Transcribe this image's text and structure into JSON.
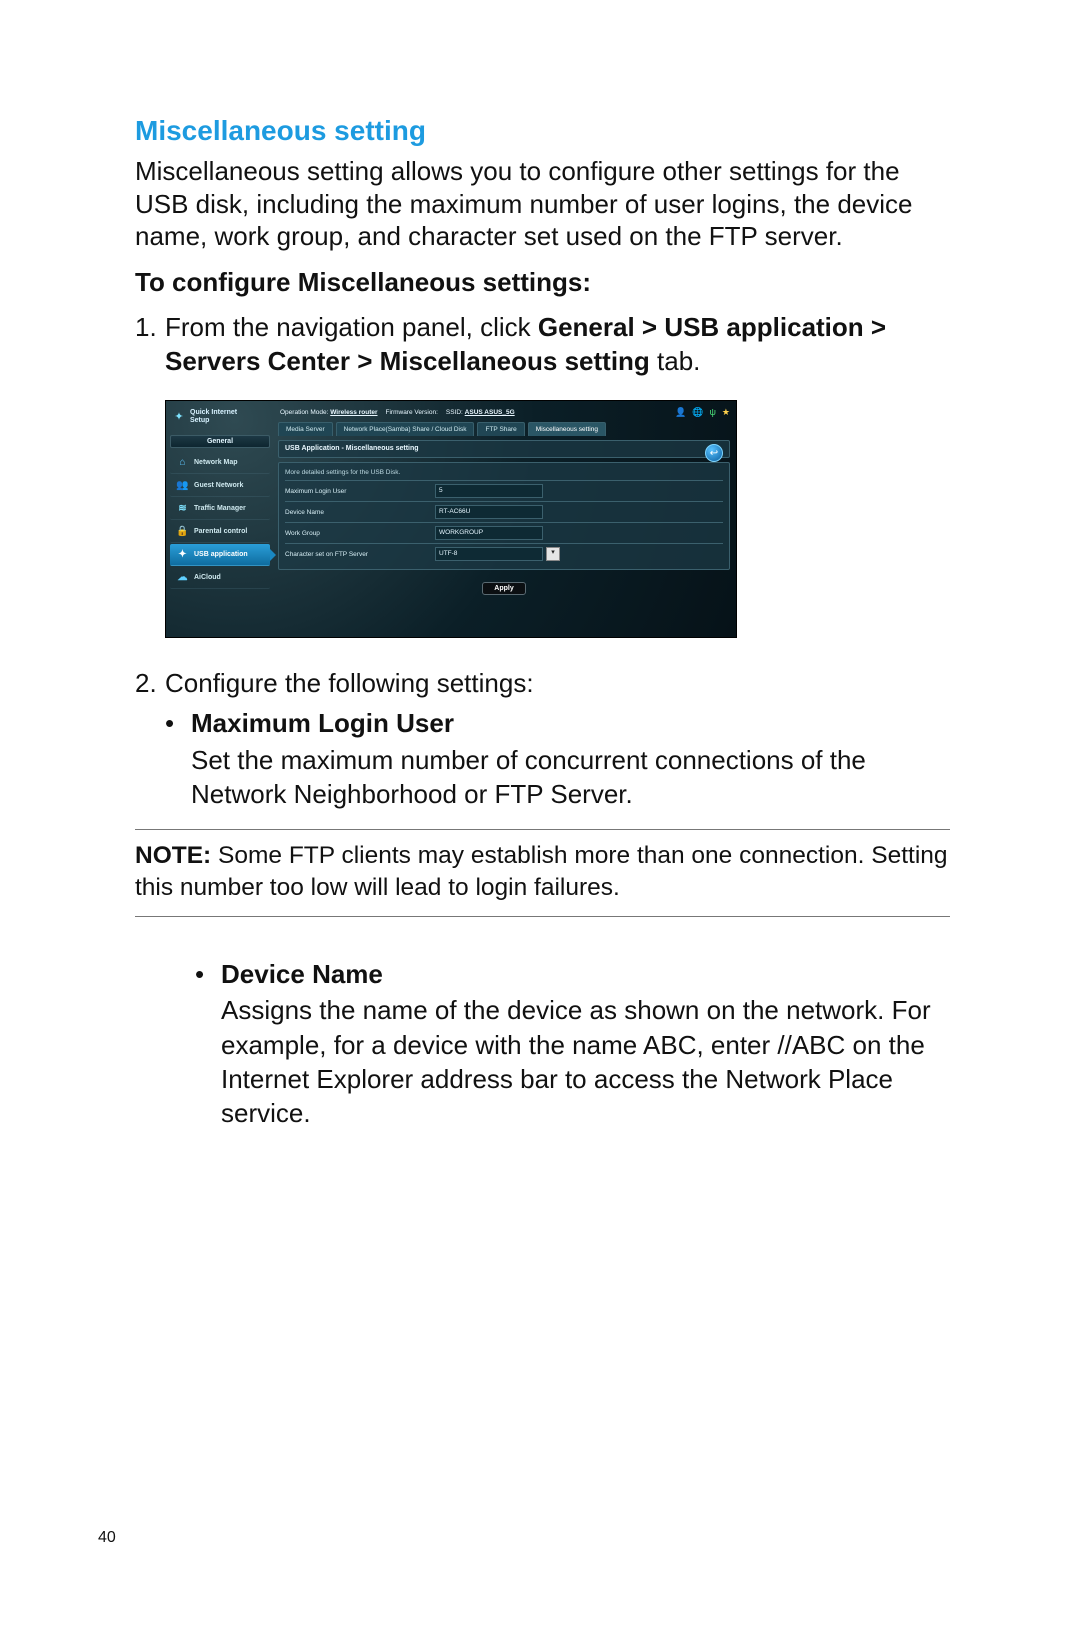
{
  "page_number": "40",
  "section_title": "Miscellaneous setting",
  "intro": "Miscellaneous setting allows you to configure other settings for the USB disk, including the maximum number of user logins, the device name, work group, and character set used on the FTP server.",
  "subhead": "To configure Miscellaneous settings:",
  "step1_num": "1.",
  "step1_a": "From the navigation panel, click ",
  "step1_b": "General > USB application > Servers Center > Miscellaneous setting",
  "step1_c": " tab.",
  "step2_num": "2.",
  "step2_text": "Configure the following settings:",
  "bullet_dot": "•",
  "bullet1_title": "Maximum Login User",
  "bullet1_desc": "Set the maximum number of concurrent connections of the Network Neighborhood or FTP Server.",
  "note_label": "NOTE:",
  "note_body": " Some FTP clients may establish more than one connection. Setting this number too low will lead to login failures.",
  "bullet2_title": "Device Name",
  "bullet2_desc": "Assigns the name of the device as shown on the network. For example, for a device with the name ABC, enter //ABC on the Internet Explorer address bar to access the Network Place service.",
  "shot": {
    "qis_line1": "Quick Internet",
    "qis_line2": "Setup",
    "general_label": "General",
    "nav": {
      "network_map": "Network Map",
      "guest_network": "Guest Network",
      "traffic_manager": "Traffic Manager",
      "parental_control": "Parental control",
      "usb_application": "USB application",
      "aicloud": "AiCloud"
    },
    "infobar": {
      "op_mode_label": "Operation Mode:",
      "op_mode_value": "Wireless router",
      "fw_label": "Firmware Version:",
      "ssid_label": "SSID:",
      "ssid_value": "ASUS  ASUS_5G"
    },
    "tabs": {
      "media_server": "Media Server",
      "network_place": "Network Place(Samba) Share / Cloud Disk",
      "ftp_share": "FTP Share",
      "misc": "Miscellaneous setting"
    },
    "panel_title": "USB Application - Miscellaneous setting",
    "panel_sub": "More detailed settings for the USB Disk.",
    "rows": {
      "max_login_label": "Maximum Login User",
      "max_login_value": "5",
      "device_name_label": "Device Name",
      "device_name_value": "RT-AC66U",
      "work_group_label": "Work Group",
      "work_group_value": "WORKGROUP",
      "charset_label": "Character set on FTP Server",
      "charset_value": "UTF-8"
    },
    "apply": "Apply"
  }
}
